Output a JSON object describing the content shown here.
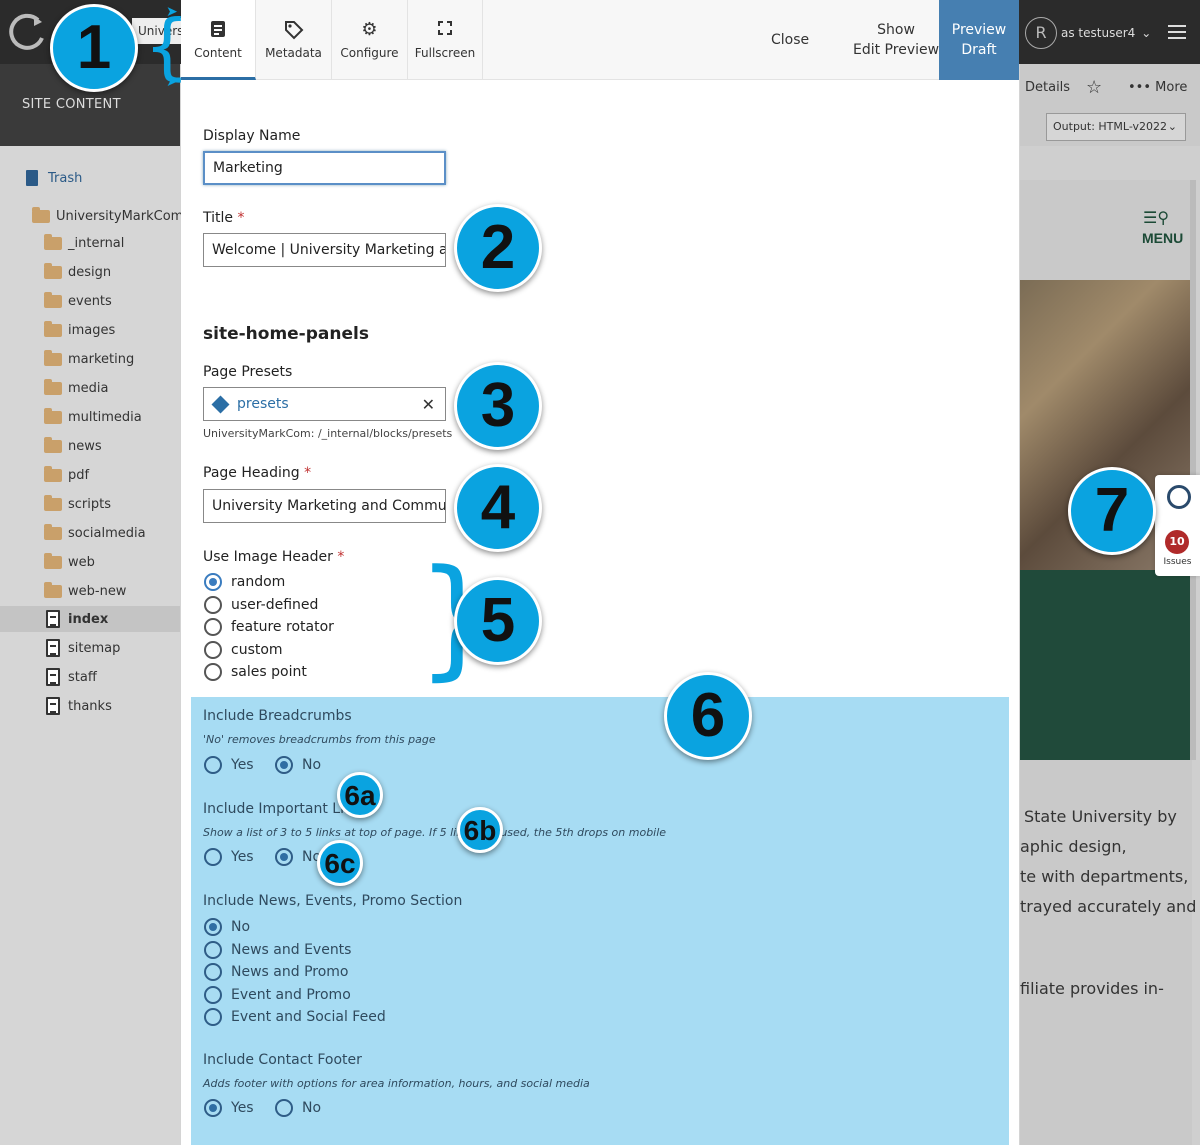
{
  "app": {
    "site_name": "UniversityMa",
    "site_content_label": "SITE CONTENT",
    "user": "as testuser4",
    "user_initial": "R"
  },
  "tree": {
    "trash": "Trash",
    "root": "UniversityMarkCom",
    "folders": [
      "_internal",
      "design",
      "events",
      "images",
      "marketing",
      "media",
      "multimedia",
      "news",
      "pdf",
      "scripts",
      "socialmedia",
      "web",
      "web-new"
    ],
    "pages": [
      "index",
      "sitemap",
      "staff",
      "thanks"
    ]
  },
  "right_panel": {
    "details": "Details",
    "more": "More",
    "output": "Output: HTML-v2022",
    "menu": "MENU",
    "text_lines": [
      "State University by",
      "aphic design,",
      "te with departments,",
      "trayed accurately and",
      "filiate provides in-"
    ],
    "issues_count": "10",
    "issues_label": "Issues"
  },
  "modal": {
    "tabs": [
      {
        "label": "Content",
        "icon": "document-icon"
      },
      {
        "label": "Metadata",
        "icon": "tag-icon"
      },
      {
        "label": "Configure",
        "icon": "gear-icon"
      },
      {
        "label": "Fullscreen",
        "icon": "expand-icon"
      }
    ],
    "close": "Close",
    "show_preview_1": "Show",
    "show_preview_2": "Edit Preview",
    "preview_draft_1": "Preview",
    "preview_draft_2": "Draft"
  },
  "form": {
    "display_name_label": "Display Name",
    "display_name_value": "Marketing",
    "title_label": "Title",
    "title_value": "Welcome | University Marketing and",
    "section_heading": "site-home-panels",
    "presets_label": "Page Presets",
    "presets_value": "presets",
    "presets_path": "UniversityMarkCom: /_internal/blocks/presets",
    "heading_label": "Page Heading",
    "heading_value": "University Marketing and Communica",
    "image_header_label": "Use Image Header",
    "image_header_options": [
      "random",
      "user-defined",
      "feature rotator",
      "custom",
      "sales point"
    ],
    "breadcrumbs_label": "Include Breadcrumbs",
    "breadcrumbs_hint": "'No' removes breadcrumbs from this page",
    "important_links_label": "Include Important Links",
    "important_links_hint": "Show a list of 3 to 5 links at top of page. If 5 links are used, the 5th drops on mobile",
    "news_label": "Include News, Events, Promo Section",
    "news_options": [
      "No",
      "News and Events",
      "News and Promo",
      "Event and Promo",
      "Event and Social Feed"
    ],
    "contact_label": "Include Contact Footer",
    "contact_hint": "Adds footer with options for area information, hours, and social media",
    "yes": "Yes",
    "no": "No",
    "required_mark": "*"
  },
  "callouts": [
    "1",
    "2",
    "3",
    "4",
    "5",
    "6",
    "6a",
    "6b",
    "6c",
    "7"
  ],
  "colors": {
    "accent": "#0aa3e0",
    "highlight": "#a7dcf3",
    "preview_draft": "#467fb1",
    "radio": "#3a7cbf"
  }
}
